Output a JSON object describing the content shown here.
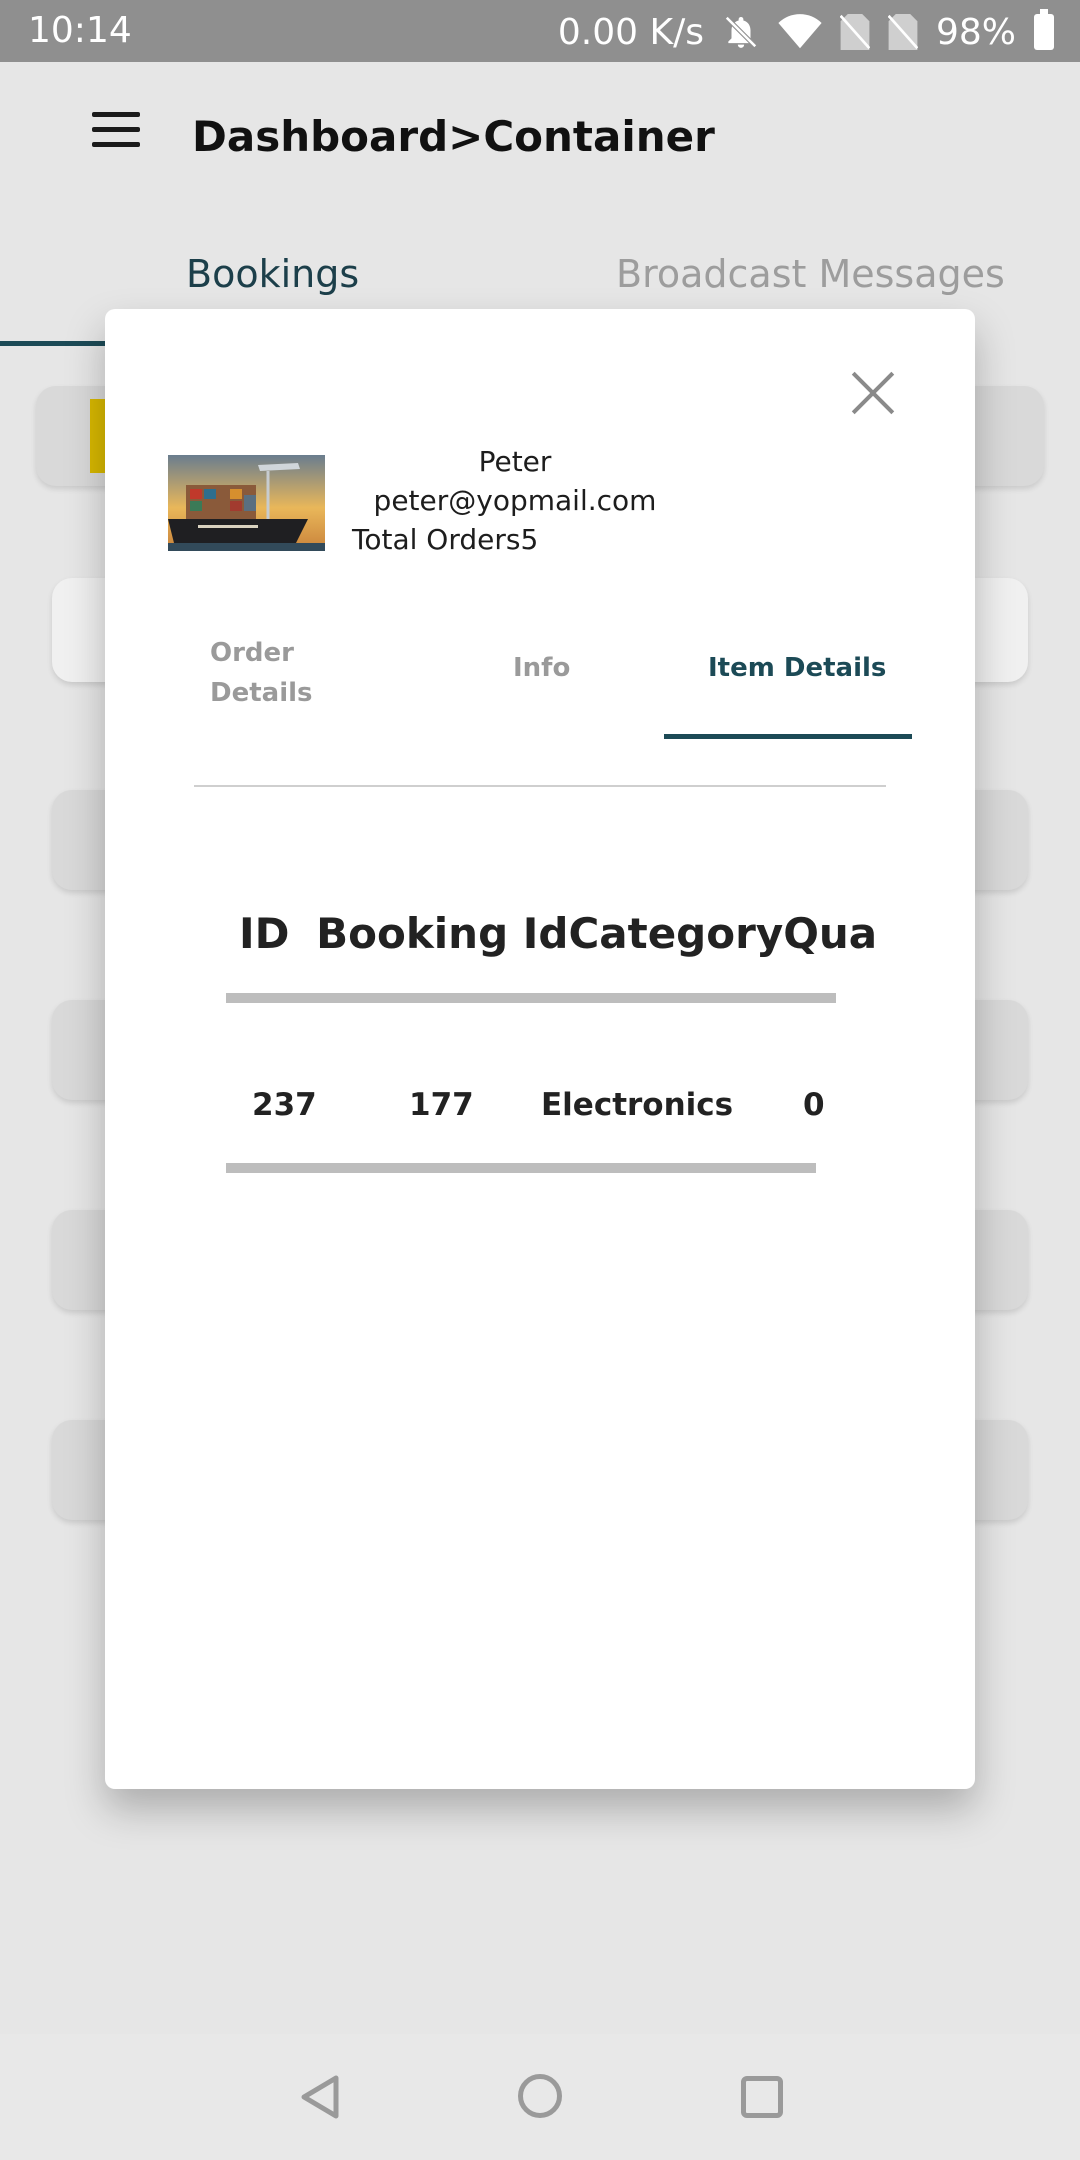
{
  "status_bar": {
    "time": "10:14",
    "network_speed": "0.00 K/s",
    "battery": "98%",
    "icons": [
      "bell-off-icon",
      "wifi-icon",
      "no-sim-icon",
      "no-sim-icon",
      "battery-icon"
    ]
  },
  "header": {
    "title": "Dashboard>Container",
    "menu_icon": "hamburger-icon"
  },
  "main_tabs": [
    {
      "label": "Bookings",
      "active": true
    },
    {
      "label": "Broadcast Messages",
      "active": false
    }
  ],
  "dialog": {
    "close_icon": "close-icon",
    "user": {
      "name": "Peter",
      "email": "peter@yopmail.com",
      "total_orders": "Total Orders5"
    },
    "tabs": [
      {
        "label": "Order Details",
        "active": false
      },
      {
        "label": "Info",
        "active": false
      },
      {
        "label": "Item Details",
        "active": true
      }
    ],
    "table": {
      "columns": [
        "ID",
        "Booking Id",
        "Category",
        "Quantity"
      ],
      "rows": [
        [
          "237",
          "177",
          "Electronics",
          "0"
        ]
      ]
    }
  },
  "colors": {
    "accent": "#1c4a56",
    "status_bar": "#8f8f8f",
    "highlight": "#d8b800"
  },
  "nav_bar": {
    "icons": [
      "back-icon",
      "home-icon",
      "recents-icon"
    ]
  }
}
